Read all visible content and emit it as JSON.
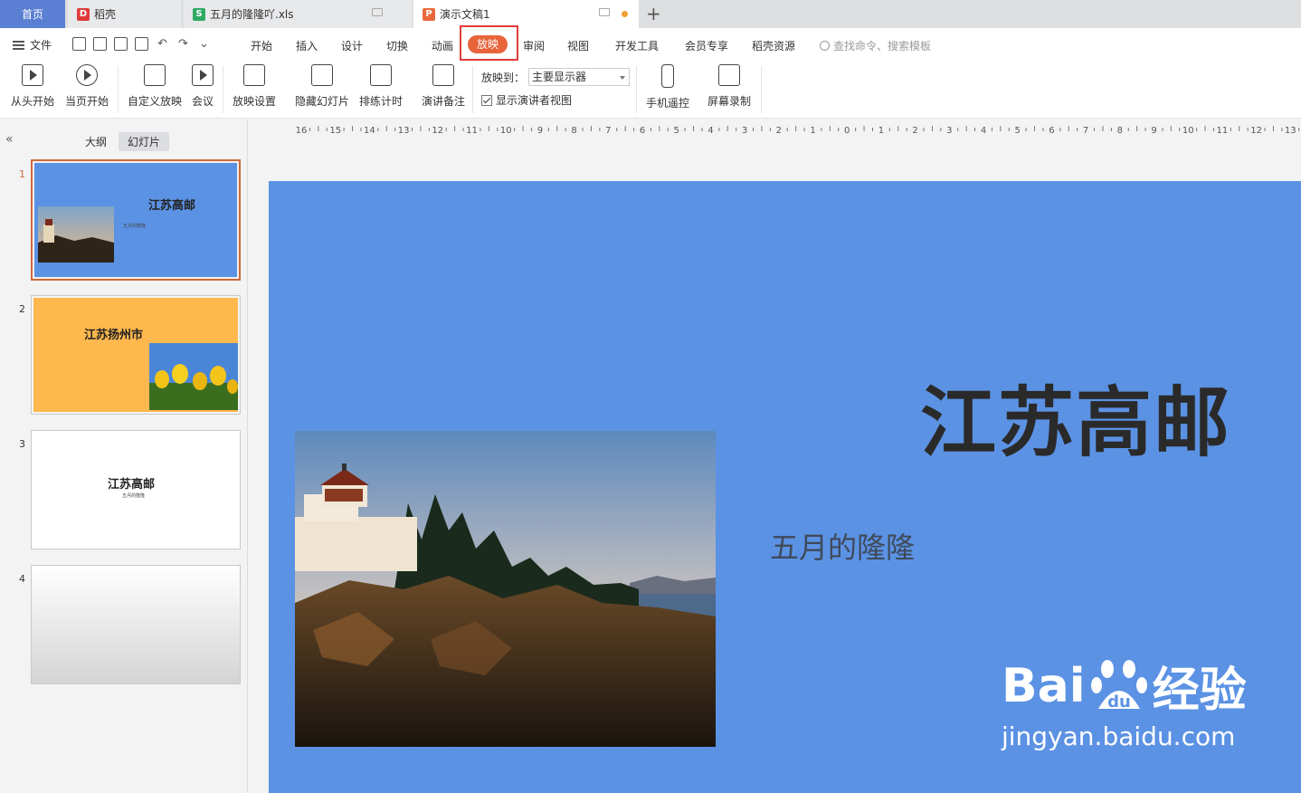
{
  "tabs": {
    "home": "首页",
    "daoke": "稻壳",
    "xls": "五月的隆隆吖.xls",
    "ppt": "演示文稿1",
    "add": "+",
    "daoke_icon_letter": "D",
    "xls_icon_letter": "S",
    "ppt_icon_letter": "P"
  },
  "menu": {
    "file": "文件",
    "items": [
      "开始",
      "插入",
      "设计",
      "切换",
      "动画",
      "放映",
      "审阅",
      "视图",
      "开发工具",
      "会员专享",
      "稻壳资源"
    ],
    "active": "放映",
    "search_placeholder": "查找命令、搜索模板",
    "undo_glyph": "↶",
    "redo_glyph": "↷",
    "more_glyph": "⌄"
  },
  "ribbon": {
    "from_start": "从头开始",
    "from_current": "当页开始",
    "custom_show": "自定义放映",
    "meeting": "会议",
    "show_settings": "放映设置",
    "hide_slide": "隐藏幻灯片",
    "rehearse": "排练计时",
    "speaker_notes": "演讲备注",
    "play_to_label": "放映到：",
    "play_to_value": "主要显示器",
    "presenter_view": "显示演讲者视图",
    "phone_remote": "手机遥控",
    "screen_record": "屏幕录制"
  },
  "panel": {
    "collapse_glyph": "«",
    "tab_outline": "大纲",
    "tab_slides": "幻灯片",
    "thumbs": [
      {
        "num": "1",
        "title": "江苏高邮",
        "sub": "五月的隆隆"
      },
      {
        "num": "2",
        "title": "江苏扬州市"
      },
      {
        "num": "3",
        "title": "江苏高邮",
        "sub": "五月的隆隆"
      },
      {
        "num": "4"
      }
    ]
  },
  "ruler": {
    "labels": [
      "16",
      "15",
      "14",
      "13",
      "12",
      "11",
      "10",
      "9",
      "8",
      "7",
      "6",
      "5",
      "4",
      "3",
      "2",
      "1",
      "0",
      "1",
      "2",
      "3",
      "4",
      "5",
      "6",
      "7",
      "8",
      "9",
      "10",
      "11",
      "12",
      "13"
    ]
  },
  "slide": {
    "title": "江苏高邮",
    "subtitle": "五月的隆隆",
    "watermark_brand": "Bai",
    "watermark_du": "du",
    "watermark_cn": "经验",
    "watermark_url": "jingyan.baidu.com"
  },
  "colors": {
    "accent": "#e8643a",
    "slide_bg": "#5b92e4",
    "slide2_bg": "#ffb84d",
    "home_tab": "#5b7fd3"
  }
}
